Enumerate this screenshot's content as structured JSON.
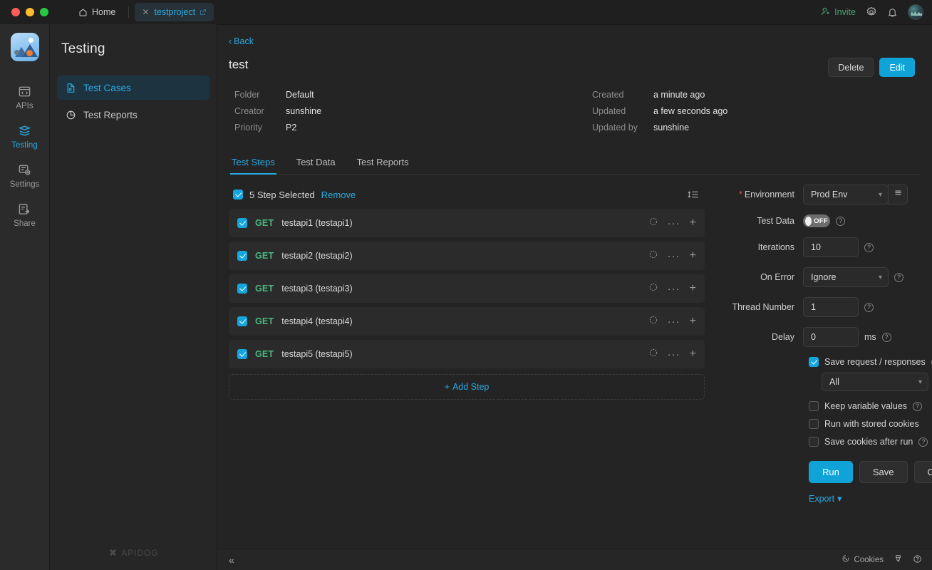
{
  "titlebar": {
    "home_tab": "Home",
    "project_tab": "testproject",
    "invite": "Invite",
    "icons": [
      "home-icon",
      "close-icon",
      "external-link-icon",
      "invite-icon",
      "gear-icon",
      "bell-icon",
      "avatar"
    ]
  },
  "rail": {
    "items": [
      {
        "label": "APIs",
        "icon": "apis-icon",
        "active": false
      },
      {
        "label": "Testing",
        "icon": "testing-icon",
        "active": true
      },
      {
        "label": "Settings",
        "icon": "settings-icon",
        "active": false
      },
      {
        "label": "Share",
        "icon": "share-icon",
        "active": false
      }
    ]
  },
  "sidebar": {
    "title": "Testing",
    "items": [
      {
        "label": "Test Cases",
        "icon": "test-case-icon",
        "active": true
      },
      {
        "label": "Test Reports",
        "icon": "pie-chart-icon",
        "active": false
      }
    ],
    "footer_brand": "APIDOG"
  },
  "main": {
    "back": "Back",
    "doc_title": "test",
    "actions": {
      "delete": "Delete",
      "edit": "Edit"
    },
    "meta": {
      "folder_label": "Folder",
      "folder_value": "Default",
      "creator_label": "Creator",
      "creator_value": "sunshine",
      "priority_label": "Priority",
      "priority_value": "P2",
      "created_label": "Created",
      "created_value": "a minute ago",
      "updated_label": "Updated",
      "updated_value": "a few seconds ago",
      "updated_by_label": "Updated by",
      "updated_by_value": "sunshine"
    },
    "tabs": [
      {
        "label": "Test Steps",
        "active": true
      },
      {
        "label": "Test Data",
        "active": false
      },
      {
        "label": "Test Reports",
        "active": false
      }
    ]
  },
  "steps": {
    "selection_text": "5 Step Selected",
    "remove_label": "Remove",
    "sort_icon": "sort-list-icon",
    "rows": [
      {
        "method": "GET",
        "name": "testapi1 (testapi1)",
        "checked": true
      },
      {
        "method": "GET",
        "name": "testapi2 (testapi2)",
        "checked": true
      },
      {
        "method": "GET",
        "name": "testapi3 (testapi3)",
        "checked": true
      },
      {
        "method": "GET",
        "name": "testapi4 (testapi4)",
        "checked": true
      },
      {
        "method": "GET",
        "name": "testapi5 (testapi5)",
        "checked": true
      }
    ],
    "add_step": "Add Step"
  },
  "config": {
    "environment_label": "Environment",
    "environment_value": "Prod Env",
    "test_data_label": "Test Data",
    "test_data_toggle": "OFF",
    "iterations_label": "Iterations",
    "iterations_value": "10",
    "on_error_label": "On Error",
    "on_error_value": "Ignore",
    "thread_number_label": "Thread Number",
    "thread_number_value": "1",
    "delay_label": "Delay",
    "delay_value": "0",
    "delay_unit": "ms",
    "save_requests_label": "Save request / responses",
    "save_requests_checked": true,
    "save_scope_value": "All",
    "keep_variable_label": "Keep variable values",
    "keep_variable_checked": false,
    "stored_cookies_label": "Run with stored cookies",
    "stored_cookies_checked": false,
    "save_cookies_label": "Save cookies after run",
    "save_cookies_checked": false,
    "run_label": "Run",
    "save_label": "Save",
    "cicd_label": "CI/CD",
    "export_label": "Export"
  },
  "footer": {
    "collapse_icon": "collapse-left-icon",
    "cookies_label": "Cookies",
    "gift_icon": "gift-icon",
    "help_icon": "help-icon"
  },
  "colors": {
    "accent": "#0fa3d8",
    "accent_text": "#29a8e0",
    "method_get": "#49b87f",
    "required": "#e0524a",
    "page_bg": "#242424",
    "panel_bg": "#2b2b2b"
  }
}
